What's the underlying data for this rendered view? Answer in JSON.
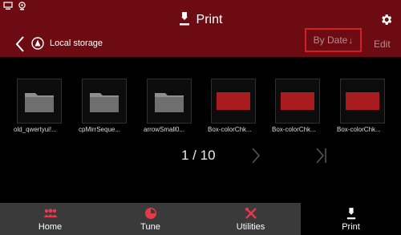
{
  "header": {
    "title": "Print"
  },
  "subheader": {
    "location": "Local storage",
    "sort_label": "By Date",
    "sort_arrow": "↓",
    "edit_label": "Edit"
  },
  "files": [
    {
      "name": "old_qwertyui!...",
      "type": "folder"
    },
    {
      "name": "cpMirrSeque...",
      "type": "folder"
    },
    {
      "name": "arrowSmall0...",
      "type": "folder"
    },
    {
      "name": "Box-colorChk...",
      "type": "file"
    },
    {
      "name": "Box-colorChk...",
      "type": "file"
    },
    {
      "name": "Box-colorChk...",
      "type": "file"
    }
  ],
  "pagination": {
    "text": "1 / 10"
  },
  "nav": {
    "home": "Home",
    "tune": "Tune",
    "utilities": "Utilities",
    "print": "Print"
  },
  "colors": {
    "accent": "#6d0b12",
    "highlight": "#d1201f",
    "thumb_red": "#a81b1f"
  }
}
